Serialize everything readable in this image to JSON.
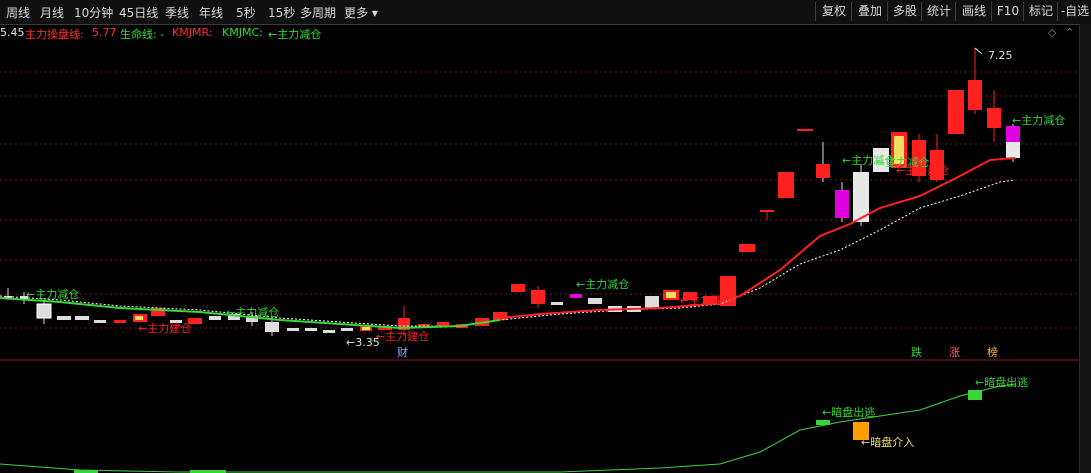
{
  "toolbar": {
    "periods": [
      "周线",
      "月线",
      "10分钟",
      "45日线",
      "季线",
      "年线",
      "5秒",
      "15秒",
      "多周期",
      "更多 ▾"
    ],
    "right_buttons": [
      "复权",
      "叠加",
      "多股",
      "统计",
      "画线",
      "F10",
      "标记",
      "-自选"
    ]
  },
  "indicator": {
    "y_value_label": "5.45",
    "main_line_label": "主力操盘线:",
    "main_line_value": "5.77",
    "life_line_label": "生命线: -",
    "kmjmr_label": "KMJMR:",
    "kmjmc_label": "KMJMC:",
    "kmjmc_text": "←主力减仓"
  },
  "icons": {
    "diamond": "◇",
    "chevron": "⌃"
  },
  "annotations": {
    "high_price": "7.25",
    "low_price": "←3.35",
    "reduce_1": "←主力减仓",
    "build_1": "←主力建仓",
    "reduce_2": "←主力减仓",
    "build_2": "←主力建仓",
    "reduce_3": "←主力减仓",
    "build_3": "←主力建仓",
    "reduce_4": "←主力减仓",
    "reduce_5": "←主力减仓",
    "reduce_6": "←主力减仓",
    "build_4": "←主力建仓",
    "cai_marker": "财",
    "die_marker": "跌",
    "zhang_marker": "涨",
    "bang_marker": "榜",
    "dark_escape_1": "←暗盘出逃",
    "dark_enter": "←暗盘介入",
    "dark_escape_2": "←暗盘出逃"
  },
  "colors": {
    "up": "#ff2020",
    "down": "#e8e8e8",
    "main_line": "#ff2020",
    "life_line": "#ffffff",
    "green_line": "#39d639",
    "grid": "#6b1a2a",
    "magenta": "#e000e0",
    "yellow": "#f0e060",
    "orange": "#ffa000"
  }
}
